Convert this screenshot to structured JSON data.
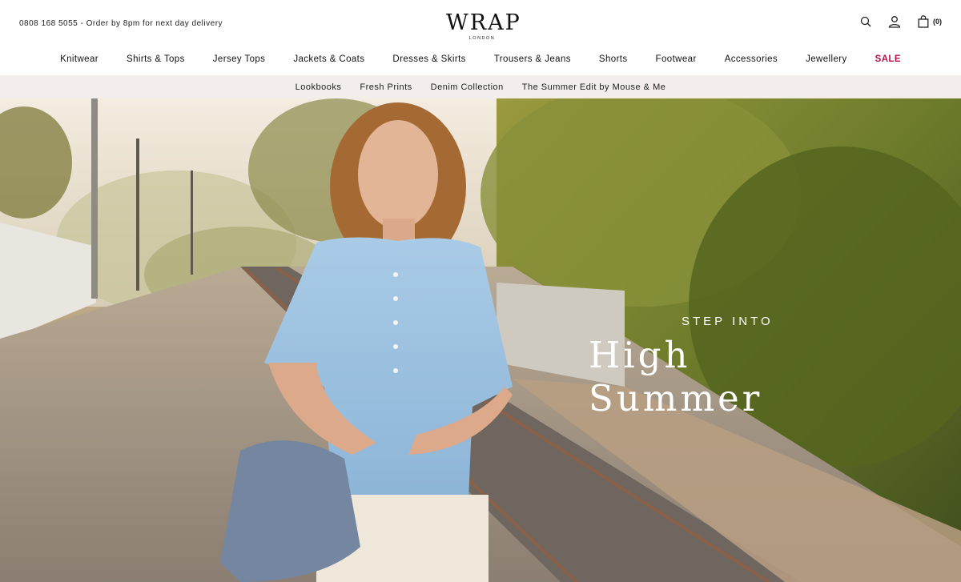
{
  "header": {
    "promo_text": "0808 168 5055 - Order by 8pm for next day delivery",
    "logo": {
      "name": "WRAP",
      "sub": "LONDON"
    },
    "icons": [
      "search-icon",
      "account-icon",
      "bag-icon"
    ],
    "bag_count": "(0)"
  },
  "nav": {
    "items": [
      {
        "label": "Knitwear"
      },
      {
        "label": "Shirts & Tops"
      },
      {
        "label": "Jersey Tops"
      },
      {
        "label": "Jackets & Coats"
      },
      {
        "label": "Dresses & Skirts"
      },
      {
        "label": "Trousers & Jeans"
      },
      {
        "label": "Shorts"
      },
      {
        "label": "Footwear"
      },
      {
        "label": "Accessories"
      },
      {
        "label": "Jewellery"
      },
      {
        "label": "SALE"
      }
    ],
    "sale_color": "#b3124a"
  },
  "subnav": {
    "items": [
      {
        "label": "Lookbooks"
      },
      {
        "label": "Fresh Prints"
      },
      {
        "label": "Denim Collection"
      },
      {
        "label": "The Summer Edit by Mouse & Me"
      }
    ],
    "background": "#f3eeeb"
  },
  "hero": {
    "eyebrow": "STEP INTO",
    "title": "High Summer"
  }
}
